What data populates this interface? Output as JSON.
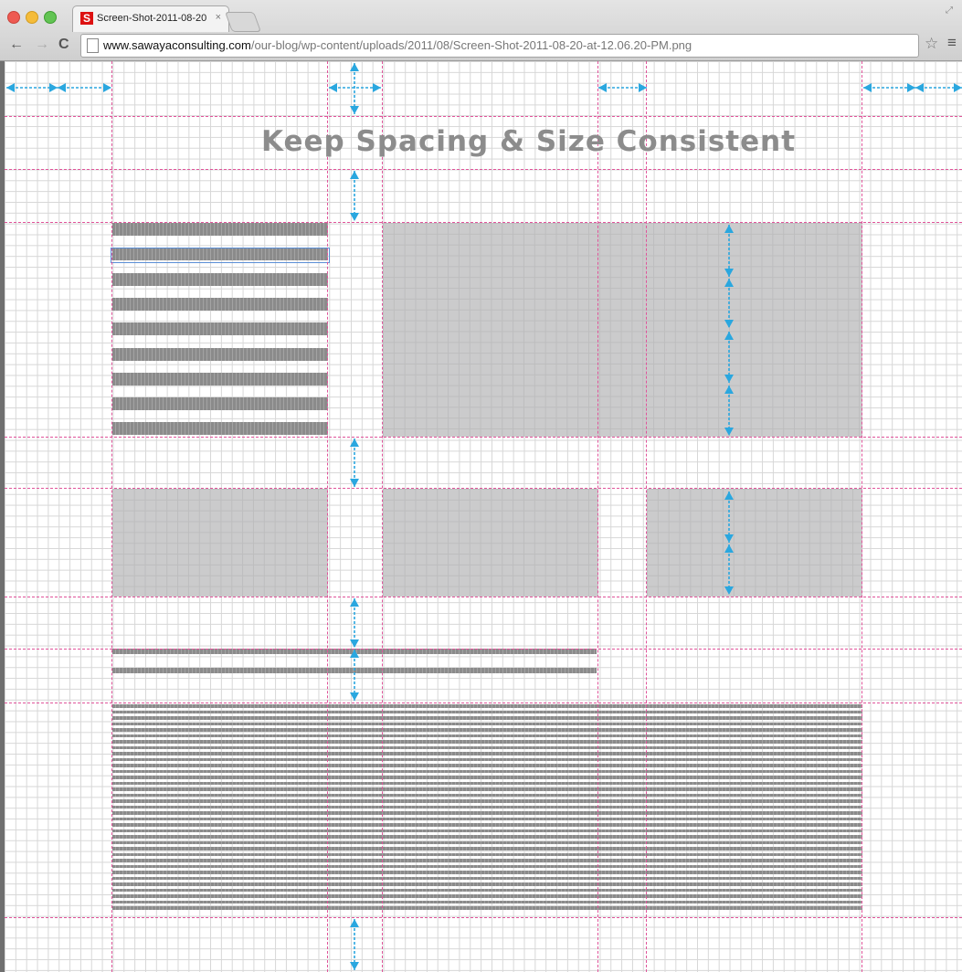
{
  "browser": {
    "tab_title": "Screen-Shot-2011-08-20",
    "tab_close": "×",
    "favicon_letter": "S",
    "url_domain": "www.sawayaconsulting.com",
    "url_path": "/our-blog/wp-content/uploads/2011/08/Screen-Shot-2011-08-20-at-12.06.20-PM.png",
    "nav": {
      "back": "←",
      "forward": "→",
      "reload": "C"
    },
    "bookmark_icon": "star-icon",
    "menu_icon": "hamburger-menu-icon"
  },
  "image": {
    "heading": "Keep Spacing & Size Consistent",
    "colors": {
      "guide_line": "#e0549a",
      "arrow": "#2aa7df",
      "placeholder": "#cbcbcc",
      "text_stripe": "#8b8b8b"
    }
  }
}
